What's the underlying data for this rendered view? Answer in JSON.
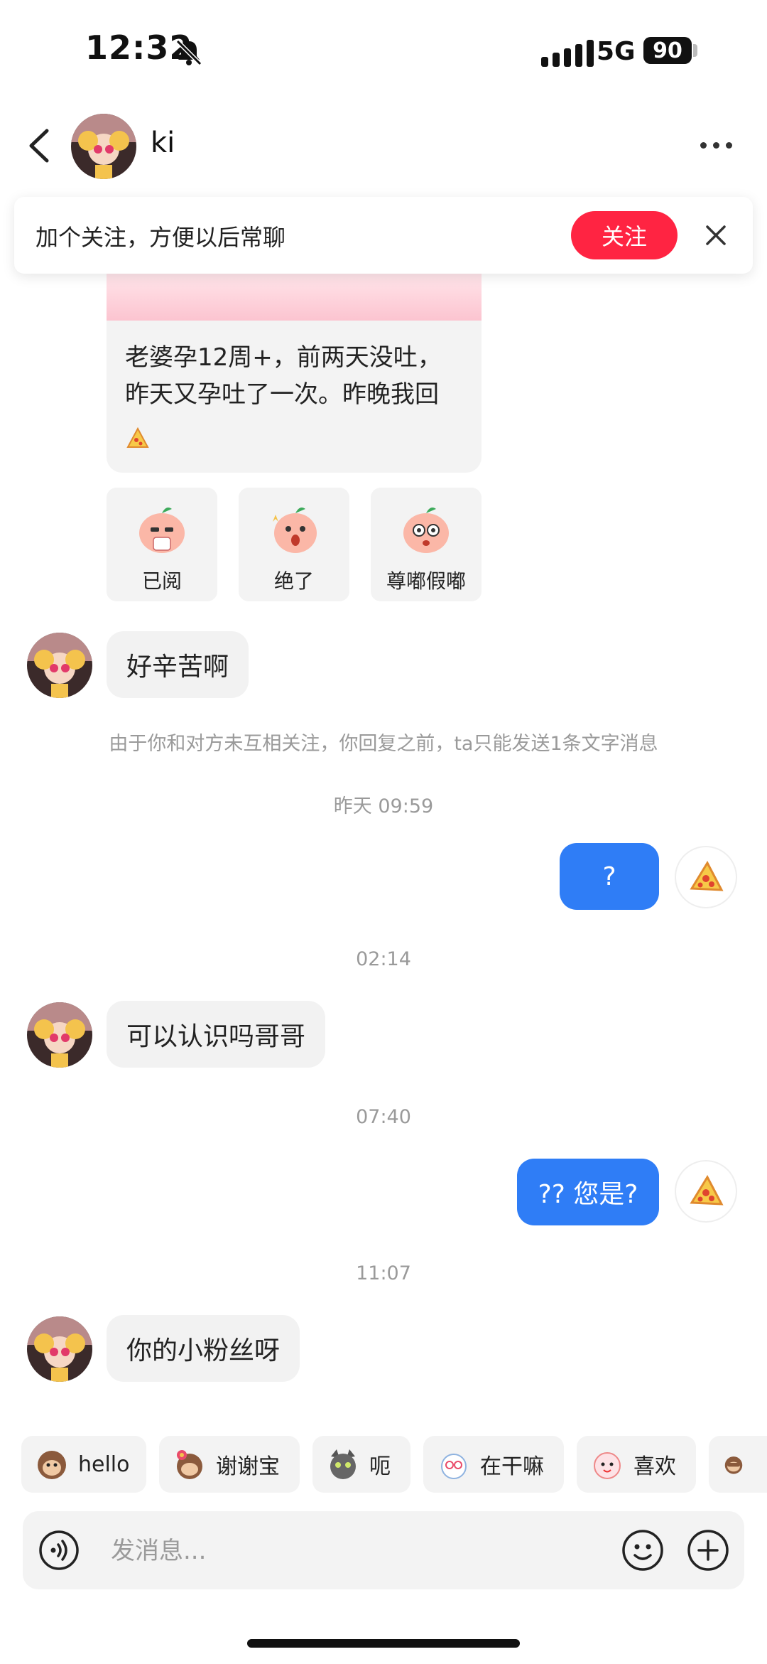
{
  "status": {
    "time": "12:32",
    "network": "5G",
    "battery": "90"
  },
  "header": {
    "title": "ki"
  },
  "banner": {
    "text": "加个关注，方便以后常聊",
    "follow_label": "关注"
  },
  "note_card": {
    "line1": "老婆孕12周+，前两天没吐，",
    "line2": "昨天又孕吐了一次。昨晚我回"
  },
  "reactions": [
    {
      "label": "已阅"
    },
    {
      "label": "绝了"
    },
    {
      "label": "尊嘟假嘟"
    }
  ],
  "messages": [
    {
      "side": "in",
      "text": "好辛苦啊"
    },
    {
      "side": "system",
      "text": "由于你和对方未互相关注，你回复之前，ta只能发送1条文字消息"
    },
    {
      "side": "stamp",
      "text": "昨天 09:59"
    },
    {
      "side": "out",
      "text": "?"
    },
    {
      "side": "stamp",
      "text": "02:14"
    },
    {
      "side": "in",
      "text": "可以认识吗哥哥"
    },
    {
      "side": "stamp",
      "text": "07:40"
    },
    {
      "side": "out",
      "text": "?? 您是?"
    },
    {
      "side": "stamp",
      "text": "11:07"
    },
    {
      "side": "in",
      "text": "你的小粉丝呀"
    }
  ],
  "quick_replies": [
    {
      "label": "hello",
      "icon": "monkey-sticker-icon"
    },
    {
      "label": "谢谢宝",
      "icon": "monkey-flower-sticker-icon"
    },
    {
      "label": "呃",
      "icon": "cat-sticker-icon"
    },
    {
      "label": "在干嘛",
      "icon": "bunny-sticker-icon"
    },
    {
      "label": "喜欢",
      "icon": "pink-creature-sticker-icon"
    },
    {
      "label": "",
      "icon": "monkey-cover-sticker-icon"
    }
  ],
  "input": {
    "placeholder": "发消息..."
  },
  "colors": {
    "accent_red": "#ff2442",
    "bubble_blue": "#2f7df6",
    "bubble_gray": "#f2f2f2"
  }
}
